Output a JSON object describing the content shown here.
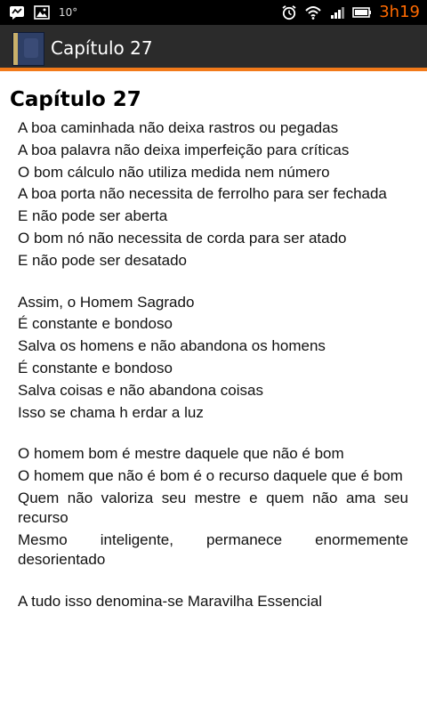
{
  "status_bar": {
    "temperature": "10°",
    "time": "3h19",
    "icons": [
      "chat-icon",
      "image-icon",
      "alarm-icon",
      "wifi-icon",
      "signal-icon",
      "battery-icon"
    ],
    "time_color": "#ff6a00"
  },
  "action_bar": {
    "title": "Capítulo 27",
    "accent_color": "#f27a1a"
  },
  "content": {
    "heading": "Capítulo 27",
    "stanza1": [
      "A boa caminhada não deixa rastros ou pegadas",
      "A boa palavra não deixa imperfeição para críticas",
      "O bom cálculo não utiliza medida nem número",
      "A boa porta não necessita de ferrolho para ser fechada",
      "E não pode ser aberta",
      "O bom nó não necessita de corda para ser atado",
      "E não pode ser desatado"
    ],
    "stanza2": [
      "Assim, o Homem Sagrado",
      "É constante e bondoso",
      "Salva os homens e não abandona os homens",
      "É constante e bondoso",
      "Salva coisas e não abandona coisas",
      "Isso se chama h erdar a luz"
    ],
    "stanza3": [
      "O homem bom é mestre daquele que não é bom",
      "O homem que não é bom é o recurso daquele que é bom",
      "Quem não valoriza seu mestre e quem não ama seu recurso",
      "Mesmo inteligente, permanece enormemente desorientado"
    ],
    "stanza4": [
      "A tudo isso denomina-se Maravilha Essencial"
    ]
  }
}
